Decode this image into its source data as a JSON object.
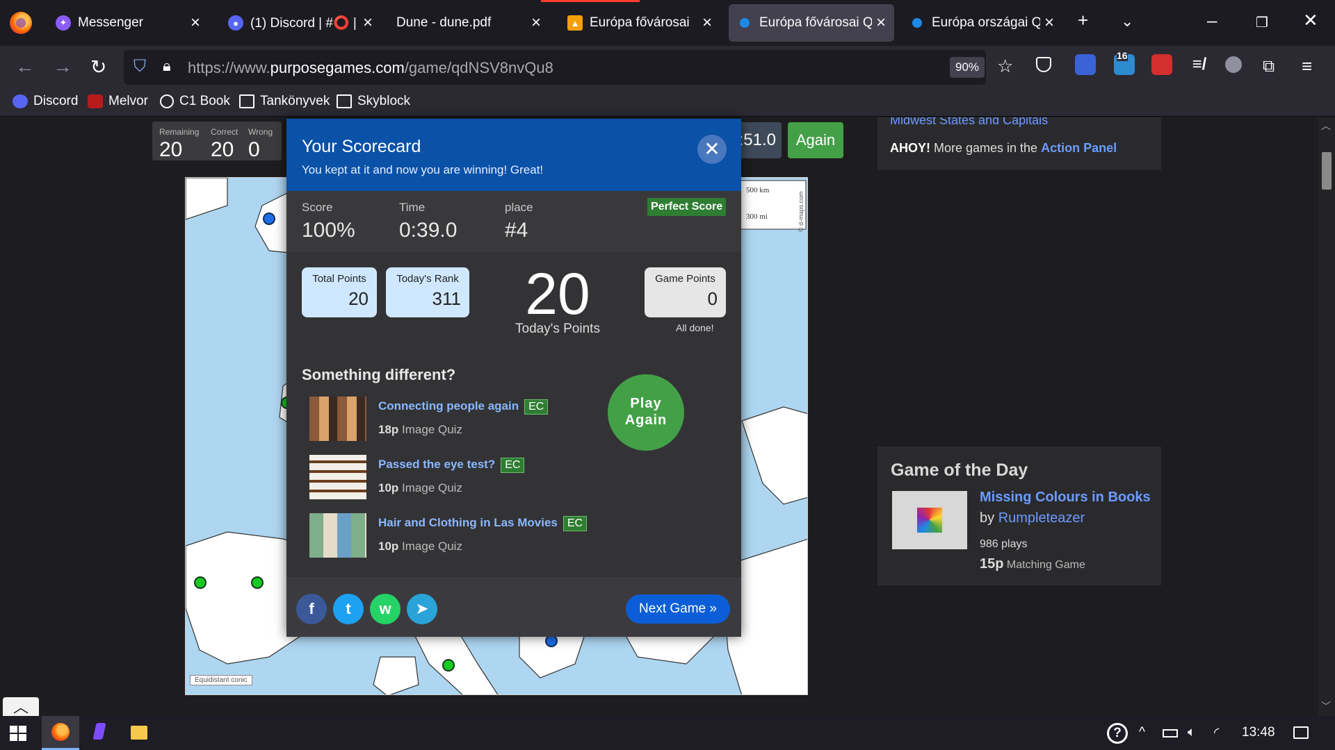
{
  "browser": {
    "tabs": [
      {
        "title": "Messenger",
        "color": "#8b5cf6",
        "glyph": "m"
      },
      {
        "title": "(1) Discord | #⭕ | ▪",
        "color": "#5865f2",
        "glyph": "d"
      },
      {
        "title": "Dune - dune.pdf",
        "color": "",
        "glyph": ""
      },
      {
        "title": "Európa fővárosai",
        "color": "#f59e0b",
        "glyph": "▲"
      },
      {
        "title": "Európa fővárosai Qu",
        "color": "#1e88e5",
        "glyph": ""
      },
      {
        "title": "Európa országai Qui",
        "color": "#1e88e5",
        "glyph": ""
      }
    ],
    "url_prefix": "https://www.",
    "url_domain": "purposegames.com",
    "url_path": "/game/qdNSV8nvQu8",
    "zoom": "90%",
    "badge_count": "16",
    "bookmarks": [
      "Discord",
      "Melvor",
      "C1 Book",
      "Tankönyvek",
      "Skyblock"
    ]
  },
  "game": {
    "remaining_label": "Remaining",
    "remaining": "20",
    "correct_label": "Correct",
    "correct": "20",
    "wrong_label": "Wrong",
    "wrong": "0",
    "timer": ":51.0",
    "again_label": "Again",
    "map_credit": "© d-maps.com",
    "scale_km": "500 km",
    "scale_mi": "300 mi",
    "projection": "Equidistant conic"
  },
  "sidebar": {
    "midwest_link": "Midwest States and Capitals",
    "ahoy_bold": "AHOY!",
    "ahoy_text": " More games in the ",
    "ahoy_link": "Action Panel",
    "gotd_title": "Game of the Day",
    "gotd_game": "Missing Colours in Books",
    "gotd_by": "by ",
    "gotd_author": "Rumpleteazer",
    "gotd_plays": "986 plays",
    "gotd_points": "15p",
    "gotd_type": " Matching Game"
  },
  "scorecard": {
    "title": "Your Scorecard",
    "subtitle": "You kept at it and now you are winning! Great!",
    "score_label": "Score",
    "score": "100%",
    "time_label": "Time",
    "time": "0:39.0",
    "place_label": "place",
    "place": "#4",
    "perfect_badge": "Perfect Score",
    "total_points_label": "Total Points",
    "total_points": "20",
    "todays_rank_label": "Today's Rank",
    "todays_rank": "311",
    "todays_points": "20",
    "todays_points_label": "Today's Points",
    "game_points_label": "Game Points",
    "game_points": "0",
    "all_done": "All done!",
    "something_different": "Something different?",
    "suggestions": [
      {
        "title": "Connecting people again",
        "tag": "EC",
        "points": "18p",
        "type": " Image Quiz"
      },
      {
        "title": "Passed the eye test?",
        "tag": "EC",
        "points": "10p",
        "type": " Image Quiz"
      },
      {
        "title": "Hair and Clothing in Las Movies",
        "tag": "EC",
        "points": "10p",
        "type": " Image Quiz"
      }
    ],
    "play_again_line1": "Play",
    "play_again_line2": "Again",
    "next_game": "Next Game »",
    "social": {
      "facebook": "f",
      "twitter": "t",
      "whatsapp": "w",
      "telegram": "➤"
    }
  },
  "taskbar": {
    "clock": "13:48"
  }
}
